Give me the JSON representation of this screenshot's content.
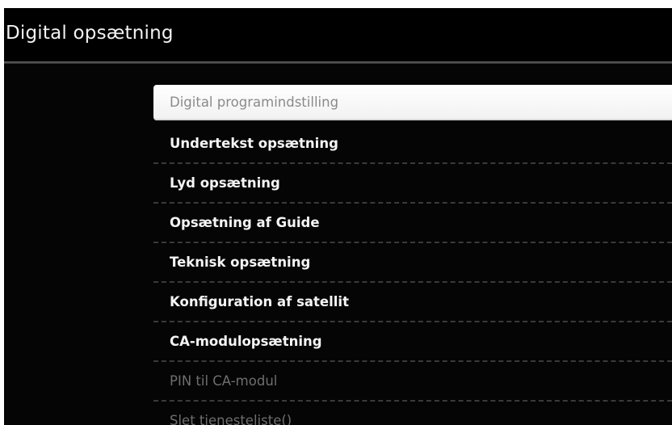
{
  "header": {
    "title": "Digital opsætning"
  },
  "menu": {
    "items": [
      {
        "label": "Digital programindstilling"
      },
      {
        "label": "Undertekst opsætning"
      },
      {
        "label": "Lyd opsætning"
      },
      {
        "label": "Opsætning af Guide"
      },
      {
        "label": "Teknisk opsætning"
      },
      {
        "label": "Konfiguration af satellit"
      },
      {
        "label": "CA-modulopsætning"
      },
      {
        "label": "PIN til CA-modul"
      },
      {
        "label": "Slet tjenesteliste()"
      }
    ]
  },
  "colors": {
    "background": "#050505",
    "text": "#f4f4f4",
    "selected_background": "#ffffff",
    "selected_text": "#8a8a8a",
    "disabled_text": "#6e6e6e"
  }
}
